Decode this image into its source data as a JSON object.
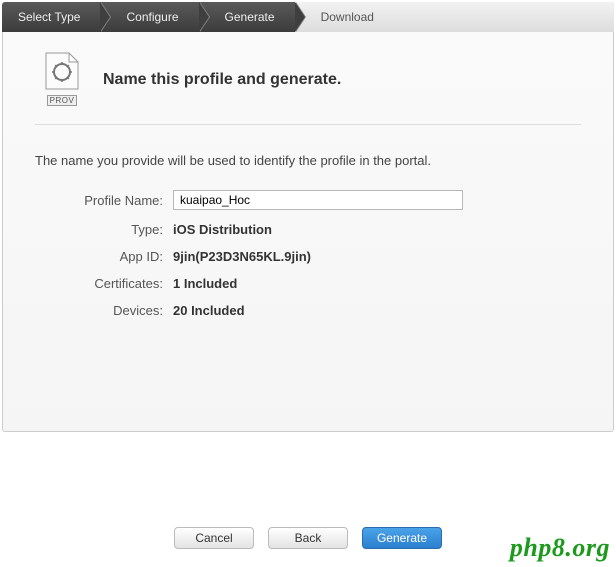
{
  "breadcrumb": {
    "step1": "Select Type",
    "step2": "Configure",
    "step3": "Generate",
    "step4": "Download"
  },
  "icon_label": "PROV",
  "title": "Name this profile and generate.",
  "description": "The name you provide will be used to identify the profile in the portal.",
  "fields": {
    "profile_name": {
      "label": "Profile Name:",
      "value": "kuaipao_Hoc"
    },
    "type": {
      "label": "Type:",
      "value": "iOS Distribution"
    },
    "app_id": {
      "label": "App ID:",
      "value": "9jin(P23D3N65KL.9jin)"
    },
    "certificates": {
      "label": "Certificates:",
      "value": "1 Included"
    },
    "devices": {
      "label": "Devices:",
      "value": "20 Included"
    }
  },
  "buttons": {
    "cancel": "Cancel",
    "back": "Back",
    "generate": "Generate"
  },
  "watermark": "php8.org"
}
